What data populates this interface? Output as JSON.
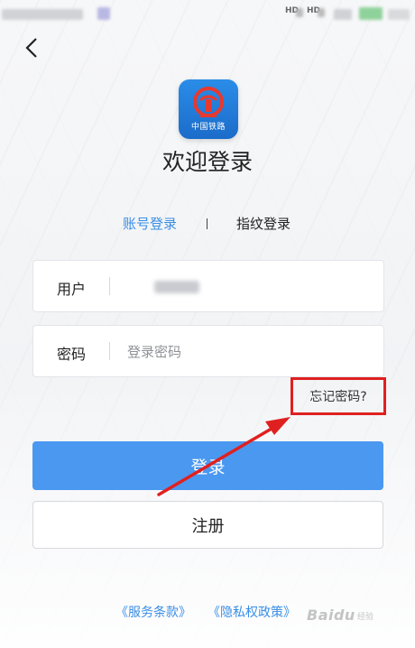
{
  "status_bar": {
    "network_1": "HD",
    "network_2": "HD"
  },
  "logo": {
    "text": "中国铁路"
  },
  "title": "欢迎登录",
  "tabs": {
    "account": "账号登录",
    "fingerprint": "指纹登录"
  },
  "user_field": {
    "label": "用户"
  },
  "password_field": {
    "label": "密码",
    "placeholder": "登录密码"
  },
  "forgot_password": "忘记密码?",
  "login_button": "登录",
  "register_button": "注册",
  "links": {
    "terms": "《服务条款》",
    "privacy": "《隐私权政策》"
  },
  "watermark": {
    "brand": "Baidu",
    "sub": "经验"
  },
  "colors": {
    "accent": "#3a8ee6",
    "login_button": "#4a98f0",
    "highlight": "#e02020"
  },
  "icons": {
    "back": "chevron-left-icon",
    "logo": "railway-logo-icon"
  }
}
